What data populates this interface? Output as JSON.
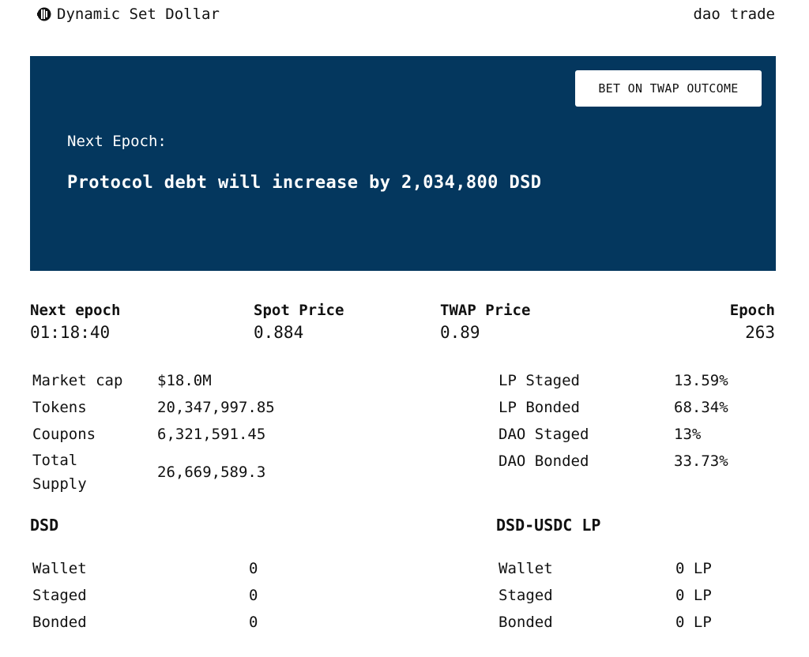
{
  "brand": {
    "name": "Dynamic Set Dollar",
    "icon": "dsd-logo-icon"
  },
  "nav": {
    "links": [
      "dao",
      "trade"
    ]
  },
  "banner": {
    "button_label": "BET ON TWAP OUTCOME",
    "label": "Next Epoch:",
    "message": "Protocol debt will increase by 2,034,800 DSD",
    "background": "#04375e"
  },
  "stats": {
    "next_epoch": {
      "label": "Next epoch",
      "value": "01:18:40"
    },
    "spot_price": {
      "label": "Spot Price",
      "value": "0.884"
    },
    "twap_price": {
      "label": "TWAP Price",
      "value": "0.89"
    },
    "epoch": {
      "label": "Epoch",
      "value": "263"
    }
  },
  "supply": [
    {
      "label": "Market cap",
      "value": "$18.0M"
    },
    {
      "label": "Tokens",
      "value": "20,347,997.85"
    },
    {
      "label": "Coupons",
      "value": "6,321,591.45"
    },
    {
      "label": "Total Supply",
      "value": "26,669,589.3"
    }
  ],
  "pool_shares": [
    {
      "label": "LP Staged",
      "value": "13.59%"
    },
    {
      "label": "LP Bonded",
      "value": "68.34%"
    },
    {
      "label": "DAO Staged",
      "value": "13%"
    },
    {
      "label": "DAO Bonded",
      "value": "33.73%"
    }
  ],
  "dsd": {
    "title": "DSD",
    "rows": [
      {
        "label": "Wallet",
        "value": "0"
      },
      {
        "label": "Staged",
        "value": "0"
      },
      {
        "label": "Bonded",
        "value": "0"
      }
    ]
  },
  "lp": {
    "title": "DSD-USDC LP",
    "rows": [
      {
        "label": "Wallet",
        "value": "0 LP"
      },
      {
        "label": "Staged",
        "value": "0 LP"
      },
      {
        "label": "Bonded",
        "value": "0 LP"
      }
    ]
  }
}
